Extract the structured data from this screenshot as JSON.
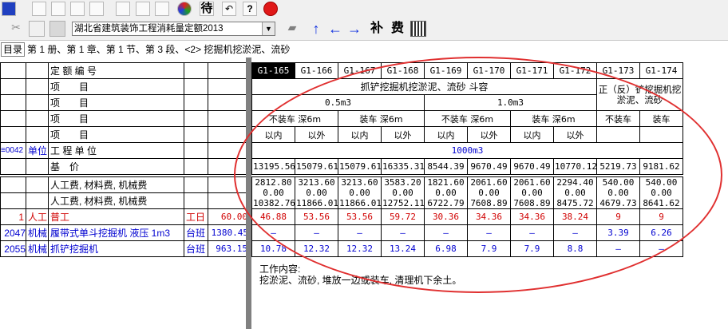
{
  "toolbar": {
    "quota_select": "湖北省建筑装饰工程消耗量定额2013",
    "btn_wait": "待",
    "btn_supplement": "补",
    "btn_fee": "费"
  },
  "path": {
    "menu": "目录",
    "text": "第 1 册、第 1 章、第 1 节、第 3 段、<2> 挖掘机挖淤泥、流砂"
  },
  "left": {
    "rows": [
      {
        "code": "",
        "cat": "",
        "name": "定 额 编 号",
        "unit": "",
        "price": ""
      },
      {
        "code": "",
        "cat": "",
        "name": "项　　目",
        "unit": "",
        "price": ""
      },
      {
        "code": "",
        "cat": "",
        "name": "项　　目",
        "unit": "",
        "price": ""
      },
      {
        "code": "",
        "cat": "",
        "name": "项　　目",
        "unit": "",
        "price": ""
      },
      {
        "code": "",
        "cat": "",
        "name": "项　　目",
        "unit": "",
        "price": ""
      },
      {
        "code": "≡0042",
        "cat": "单位",
        "name": "工 程 单 位",
        "unit": "",
        "price": ""
      },
      {
        "code": "",
        "cat": "",
        "name": "基　价",
        "unit": "",
        "price": ""
      }
    ],
    "fee_labels": [
      "人工费, 材料费, 机械费",
      "人工费, 材料费, 机械费"
    ],
    "items": [
      {
        "code": "1",
        "cat": "人工",
        "name": "普工",
        "unit": "工日",
        "price": "60.00"
      },
      {
        "code": "2047",
        "cat": "机械",
        "name": "履带式单斗挖掘机 液压 1m3",
        "unit": "台班",
        "price": "1380.45"
      },
      {
        "code": "2055",
        "cat": "机械",
        "name": "抓铲挖掘机",
        "unit": "台班",
        "price": "963.15"
      }
    ]
  },
  "right": {
    "codes": [
      "G1-165",
      "G1-166",
      "G1-167",
      "G1-168",
      "G1-169",
      "G1-170",
      "G1-171",
      "G1-172",
      "G1-173",
      "G1-174"
    ],
    "head1_a": "抓铲挖掘机挖淤泥、流砂 斗容",
    "head1_b": "正（反）铲挖掘机挖淤泥、流砂",
    "head2": [
      "0.5m3",
      "1.0m3"
    ],
    "head3": [
      "不装车 深6m",
      "装车 深6m",
      "不装车 深6m",
      "装车 深6m",
      "不装车",
      "装车"
    ],
    "head4": [
      "以内",
      "以外",
      "以内",
      "以外",
      "以内",
      "以外",
      "以内",
      "以外",
      "",
      ""
    ],
    "unit": "1000m3",
    "base": [
      "13195.56",
      "15079.61",
      "15079.61",
      "16335.31",
      "8544.39",
      "9670.49",
      "9670.49",
      "10770.12",
      "5219.73",
      "9181.62"
    ],
    "fee_l1": [
      "2812.80",
      "3213.60",
      "3213.60",
      "3583.20",
      "1821.60",
      "2061.60",
      "2061.60",
      "2294.40",
      "540.00",
      "540.00"
    ],
    "fee_l2": [
      "0.00",
      "0.00",
      "0.00",
      "0.00",
      "0.00",
      "0.00",
      "0.00",
      "0.00",
      "0.00",
      "0.00"
    ],
    "fee_l3": [
      "10382.76",
      "11866.01",
      "11866.01",
      "12752.11",
      "6722.79",
      "7608.89",
      "7608.89",
      "8475.72",
      "4679.73",
      "8641.62"
    ],
    "labor": [
      "46.88",
      "53.56",
      "53.56",
      "59.72",
      "30.36",
      "34.36",
      "34.36",
      "38.24",
      "9",
      "9"
    ],
    "mach1": [
      "–",
      "–",
      "–",
      "–",
      "–",
      "–",
      "–",
      "–",
      "3.39",
      "6.26"
    ],
    "mach2": [
      "10.78",
      "12.32",
      "12.32",
      "13.24",
      "6.98",
      "7.9",
      "7.9",
      "8.8",
      "–",
      "–"
    ]
  },
  "work": {
    "title": "工作内容:",
    "body": "挖淤泥、流砂, 堆放一边或装车, 清理机下余土。"
  }
}
